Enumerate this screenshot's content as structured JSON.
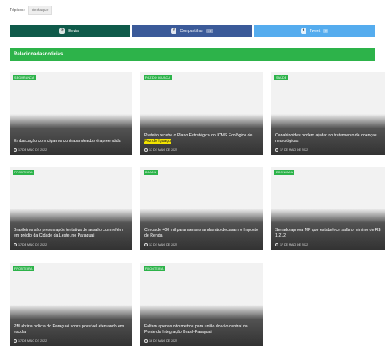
{
  "tags": {
    "label": "Tópicos:",
    "chip": "destaque"
  },
  "share": {
    "email": {
      "label": "Enviar",
      "icon": "whatsapp-icon",
      "color": "#0f5a4a"
    },
    "facebook": {
      "label": "Compartilhar",
      "count": "17",
      "icon": "facebook-icon",
      "color": "#3b5a99"
    },
    "twitter": {
      "label": "Tweet",
      "count": "0",
      "icon": "twitter-icon",
      "color": "#55acee"
    }
  },
  "section_title": "Relacionadasnoticias",
  "accent_color": "#2db34a",
  "cards": [
    {
      "badge": "SEGURANÇA",
      "title": "Embarcação com cigarros contrabandeados é apreendida",
      "title_hl": "",
      "title_after": "",
      "date": "17 DE MAIO DE 2022"
    },
    {
      "badge": "FOZ DO IGUAÇU",
      "title": "Prefeito recebe o Plano Estratégico do ICMS Ecológico de ",
      "title_hl": "Foz do Iguaçu",
      "title_after": "",
      "date": "17 DE MAIO DE 2022"
    },
    {
      "badge": "SAÚDE",
      "title": "Canabinoides podem ajudar no tratamento de doenças neurológicas",
      "title_hl": "",
      "title_after": "",
      "date": "17 DE MAIO DE 2022"
    },
    {
      "badge": "FRONTEIRA",
      "title": "Brasileiros são presos após tentativa de assalto com refém em prédio da Cidade da Leste, no Paraguai",
      "title_hl": "",
      "title_after": "",
      "date": "17 DE MAIO DE 2022"
    },
    {
      "badge": "BRASIL",
      "title": "Cerca de 400 mil paranaenses ainda não declaram o Imposto de Renda",
      "title_hl": "",
      "title_after": "",
      "date": "17 DE MAIO DE 2022"
    },
    {
      "badge": "ECONOMIA",
      "title": "Senado aprova MP que estabelece salário mínimo de R$ 1.212",
      "title_hl": "",
      "title_after": "",
      "date": "17 DE MAIO DE 2022"
    },
    {
      "badge": "FRONTEIRA",
      "title": "PM abriria policia do Paraguai sobre possível atentando em escola",
      "title_hl": "",
      "title_after": "",
      "date": "17 DE MAIO DE 2022"
    },
    {
      "badge": "FRONTEIRA",
      "title": "Faltam apenas oito metros para união do vão central da Ponte da Integração Brasil-Paraguai",
      "title_hl": "",
      "title_after": "",
      "date": "16 DE MAIO DE 2022"
    }
  ]
}
